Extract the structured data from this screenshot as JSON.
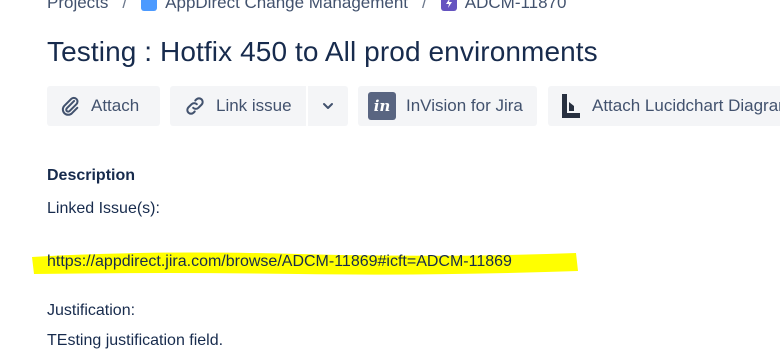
{
  "breadcrumb": {
    "items": [
      {
        "label": "Projects"
      },
      {
        "label": "AppDirect Change Management"
      },
      {
        "label": "ADCM-11870"
      }
    ],
    "separator": "/"
  },
  "issue": {
    "title": "Testing : Hotfix 450 to All prod environments"
  },
  "toolbar": {
    "attach_label": "Attach",
    "link_issue_label": "Link issue",
    "invision_label": "InVision for Jira",
    "invision_logo_text": "in",
    "lucidchart_label": "Attach Lucidchart Diagram"
  },
  "description": {
    "heading": "Description",
    "linked_issues_label": "Linked Issue(s):",
    "linked_issue_url": "https://appdirect.jira.com/browse/ADCM-11869#icft=ADCM-11869",
    "justification_label": "Justification:",
    "justification_text": "TEsting justification field."
  },
  "colors": {
    "highlight": "#ffff00",
    "button_bg": "#f4f5f7",
    "text": "#172b4d",
    "project_icon": "#4c9aff",
    "issue_icon": "#6554c0"
  }
}
